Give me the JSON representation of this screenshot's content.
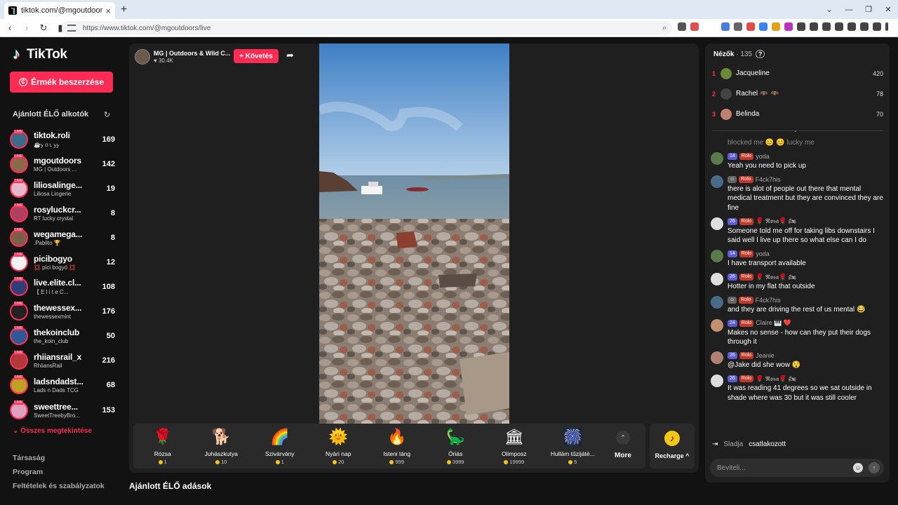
{
  "browser": {
    "tab_title": "tiktok.com/@mgoutdoors/live",
    "tab_close": "×",
    "new_tab": "+",
    "url": "https://www.tiktok.com/@mgoutdoors/live"
  },
  "sidebar": {
    "logo": "TikTok",
    "coins_button": "Érmék beszerzése",
    "section_title": "Ajánlott ÉLŐ alkotók",
    "live_tag": "LIVE",
    "creators": [
      {
        "name": "tiktok.roli",
        "sub": "☕ꭚ ᴏ ʟ ꭚꭚ",
        "count": "169",
        "color": "#3a6b8a"
      },
      {
        "name": "mgoutdoors",
        "sub": "MG | Outdoors ...",
        "count": "142",
        "color": "#8a6a4a"
      },
      {
        "name": "liliosalinge...",
        "sub": "Liliosa Lingerie",
        "count": "19",
        "color": "#e8b7c9"
      },
      {
        "name": "rosyluckcr...",
        "sub": "RT lucky crystal",
        "count": "8",
        "color": "#b04060"
      },
      {
        "name": "wegamega...",
        "sub": ".Pablito 🏆",
        "count": "8",
        "color": "#7a6048"
      },
      {
        "name": "picibogyo",
        "sub": "💢 pici bogyó 💢",
        "count": "12",
        "color": "#f2f2f2"
      },
      {
        "name": "live.elite.cl...",
        "sub": "【 E l i t e C...",
        "count": "108",
        "color": "#2d3f7a"
      },
      {
        "name": "thewessex...",
        "sub": "thewessexmint",
        "count": "176",
        "color": "#222"
      },
      {
        "name": "thekoinclub",
        "sub": "the_koin_club",
        "count": "50",
        "color": "#2a5a9a"
      },
      {
        "name": "rhiiansrail_x",
        "sub": "RhiiansRail",
        "count": "216",
        "color": "#b03a3a"
      },
      {
        "name": "ladsndadst...",
        "sub": "Lads n Dads TCG",
        "count": "68",
        "color": "#c0a020"
      },
      {
        "name": "sweettree...",
        "sub": "SweetTreebyBro...",
        "count": "153",
        "color": "#e0a0c0"
      }
    ],
    "see_all": "Összes megtekintése",
    "footer_links": [
      "Társaság",
      "Program",
      "Feltételek és szabályzatok"
    ]
  },
  "stage": {
    "host_name": "MG | Outdoors & Wild C...",
    "host_likes": "30.4K",
    "follow_button": "+ Követés",
    "gifts": [
      {
        "name": "Rózsa",
        "price": "1",
        "icon": "🌹"
      },
      {
        "name": "Juhászkutya",
        "price": "10",
        "icon": "🐕"
      },
      {
        "name": "Szivárvány",
        "price": "1",
        "icon": "🌈"
      },
      {
        "name": "Nyári nap",
        "price": "20",
        "icon": "🌞"
      },
      {
        "name": "Isteni láng",
        "price": "999",
        "icon": "🔥"
      },
      {
        "name": "Óriás",
        "price": "3999",
        "icon": "🦕"
      },
      {
        "name": "Olimposz",
        "price": "19999",
        "icon": "🏛"
      },
      {
        "name": "Hullám tűzijáté...",
        "price": "5",
        "icon": "🎆"
      }
    ],
    "more_label": "More",
    "recharge_label": "Recharge",
    "recharge_caret": "^"
  },
  "recommended_title": "Ajánlott ÉLŐ adások",
  "chat": {
    "viewers_label": "Nézők",
    "viewers_count": "· 135",
    "top_viewers": [
      {
        "rank": "1",
        "name": "Jacqueline",
        "score": "420",
        "color": "#6a8a3a"
      },
      {
        "rank": "2",
        "name": "Rachel 🦇 🦇",
        "score": "78",
        "color": "#444"
      },
      {
        "rank": "3",
        "name": "Belinda",
        "score": "70",
        "color": "#c08070"
      }
    ],
    "ghost_text": "blocked me 😊 😊 lucky me",
    "messages": [
      {
        "level": "14",
        "fan": "Rolo",
        "user": "yoda",
        "text": "Yeah you need to pick up",
        "color": "#5a7a4a"
      },
      {
        "level": "",
        "fan": "Rolo",
        "user": "F4ck7his",
        "text": "there is alot of people out there that mental medical treatment but they are convinced they are fine",
        "color": "#4a6a8a"
      },
      {
        "level": "26",
        "fan": "Rolo",
        "user": "🌹 𝕽𝖔𝖘𝖆🌹 🏍",
        "text": "Someone told me off for taking libs downstairs I said well I live up there so what else can I do",
        "color": "#ddd"
      },
      {
        "level": "14",
        "fan": "Rolo",
        "user": "yoda",
        "text": "I have transport available",
        "color": "#5a7a4a"
      },
      {
        "level": "26",
        "fan": "Rolo",
        "user": "🌹 𝕽𝖔𝖘𝖆🌹 🏍",
        "text": "Hotter in my flat that outside",
        "color": "#ddd"
      },
      {
        "level": "",
        "fan": "Rolo",
        "user": "F4ck7his",
        "text": "and they are driving the rest of us mental 😂",
        "color": "#4a6a8a"
      },
      {
        "level": "24",
        "fan": "Rolo",
        "user": "Claire 🎹 ❤️",
        "text": "Makes no sense - how can they put their dogs through it",
        "color": "#c09070"
      },
      {
        "level": "26",
        "fan": "Rolo",
        "user": "Jeanie",
        "text": "@Jake did she wow 😯",
        "color": "#b08070"
      },
      {
        "level": "26",
        "fan": "Rolo",
        "user": "🌹 𝕽𝖔𝖘𝖆🌹 🏍",
        "text": "It was reading 41 degrees so we sat outside in shade where was 30 but it was still cooler",
        "color": "#ddd"
      }
    ],
    "joined_user": "Sladja",
    "joined_text": "csatlakozott",
    "input_placeholder": "Beviteli..."
  }
}
